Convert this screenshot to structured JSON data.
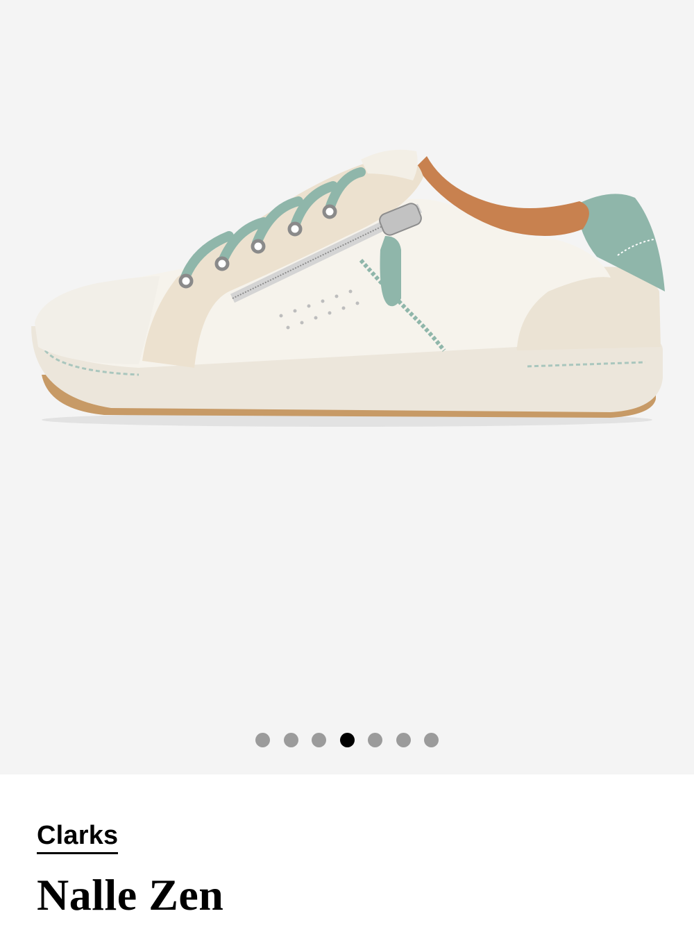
{
  "product": {
    "brand": "Clarks",
    "name": "Nalle Zen"
  },
  "gallery": {
    "image_count": 7,
    "active_index": 4,
    "image_subject": "shoe-image"
  },
  "colors": {
    "gallery_background": "#f4f4f4",
    "dot_inactive": "#9b9b9b",
    "dot_active": "#000000",
    "text": "#000000"
  }
}
